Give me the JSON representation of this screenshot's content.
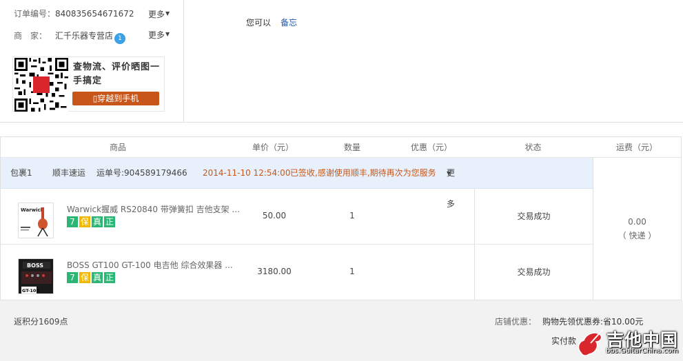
{
  "order": {
    "number_label": "订单编号：",
    "number_value": "840835654671672",
    "seller_label": "商　家：",
    "seller_value": "汇千乐器专营店",
    "seller_badge": "1",
    "more_label": "更多",
    "qr_text": "查物流、评价晒图一手搞定",
    "qr_button": "穿越到手机",
    "qr_center": "天猫"
  },
  "note": {
    "prefix": "您可以",
    "link": "备忘"
  },
  "table": {
    "headers": {
      "product": "商品",
      "unit_price": "单价（元）",
      "qty": "数量",
      "discount": "优惠（元）",
      "status": "状态",
      "freight": "运费（元）"
    },
    "package": {
      "name": "包裹1",
      "carrier": "顺丰速运",
      "tracking": "运单号:904589179466",
      "time": "2014-11-10 12:54:00",
      "message": "已签收,感谢使用顺丰,期待再次为您服务",
      "more": "更多"
    },
    "freight_value": "0.00",
    "freight_type": "（ 快递 ）",
    "items": [
      {
        "title": "Warwick握威 RS20840 带弹簧扣 吉他支架 ...",
        "price": "50.00",
        "qty": "1",
        "status": "交易成功",
        "tags": [
          "7",
          "保",
          "真",
          "正"
        ],
        "thumb_brand": "Warwick"
      },
      {
        "title": "BOSS GT100 GT-100 电吉他 综合效果器 ...",
        "price": "3180.00",
        "qty": "1",
        "status": "交易成功",
        "tags": [
          "7",
          "保",
          "真",
          "正"
        ],
        "thumb_brand": "BOSS",
        "thumb_model": "GT-100"
      }
    ]
  },
  "footer": {
    "points": "返积分1609点",
    "shop_discount_label": "店铺优惠：",
    "shop_discount_value": "购物先领优惠券:省10.00元",
    "paid_label": "实付款"
  },
  "watermark": {
    "text": "吉他中国",
    "url": "bbs.GuitarChina.com"
  },
  "colors": {
    "accent_orange": "#c8561a",
    "link_blue": "#1e5aa8",
    "package_bg": "#e8f1fb",
    "tag_green": "#2bb673",
    "tag_gold": "#f0b800"
  }
}
